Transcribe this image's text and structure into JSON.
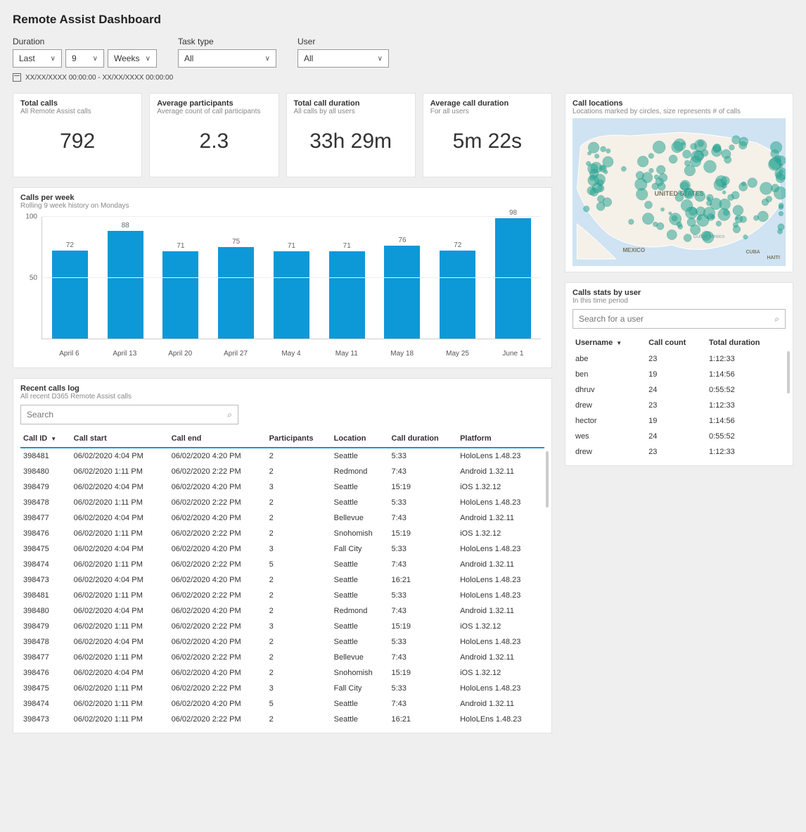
{
  "page": {
    "title": "Remote Assist Dashboard"
  },
  "filters": {
    "duration_label": "Duration",
    "duration_period": "Last",
    "duration_number": "9",
    "duration_unit": "Weeks",
    "task_label": "Task type",
    "task_value": "All",
    "user_label": "User",
    "user_value": "All",
    "date_range": "XX/XX/XXXX 00:00:00 - XX/XX/XXXX 00:00:00"
  },
  "kpis": [
    {
      "title": "Total calls",
      "subtitle": "All Remote Assist calls",
      "value": "792"
    },
    {
      "title": "Average participants",
      "subtitle": "Average count of call participants",
      "value": "2.3"
    },
    {
      "title": "Total call duration",
      "subtitle": "All calls by all users",
      "value": "33h 29m"
    },
    {
      "title": "Average call duration",
      "subtitle": "For all users",
      "value": "5m 22s"
    }
  ],
  "chart_data": {
    "type": "bar",
    "title": "Calls per week",
    "subtitle": "Rolling 9 week history on Mondays",
    "categories": [
      "April 6",
      "April 13",
      "April 20",
      "April 27",
      "May 4",
      "May 11",
      "May 18",
      "May 25",
      "June 1"
    ],
    "values": [
      72,
      88,
      71,
      75,
      71,
      71,
      76,
      72,
      98
    ],
    "ylim": [
      0,
      100
    ],
    "yticks": [
      50,
      100
    ],
    "xlabel": "",
    "ylabel": ""
  },
  "map": {
    "title": "Call locations",
    "subtitle": "Locations marked by circles, size represents # of calls",
    "country_label": "UNITED STATES",
    "gulf_label": "Gulf of Mexico",
    "mexico_label": "MEXICO",
    "cuba_label": "CUBA",
    "haiti_label": "HAITI"
  },
  "user_stats": {
    "title": "Calls stats by user",
    "subtitle": "In this time period",
    "search_placeholder": "Search for a user",
    "columns": {
      "username": "Username",
      "count": "Call count",
      "duration": "Total duration"
    },
    "rows": [
      {
        "username": "abe",
        "count": "23",
        "duration": "1:12:33"
      },
      {
        "username": "ben",
        "count": "19",
        "duration": "1:14:56"
      },
      {
        "username": "dhruv",
        "count": "24",
        "duration": "0:55:52"
      },
      {
        "username": "drew",
        "count": "23",
        "duration": "1:12:33"
      },
      {
        "username": "hector",
        "count": "19",
        "duration": "1:14:56"
      },
      {
        "username": "wes",
        "count": "24",
        "duration": "0:55:52"
      },
      {
        "username": "drew",
        "count": "23",
        "duration": "1:12:33"
      }
    ]
  },
  "calls_log": {
    "title": "Recent calls log",
    "subtitle": "All recent D365 Remote Assist calls",
    "search_placeholder": "Search",
    "columns": {
      "id": "Call ID",
      "start": "Call start",
      "end": "Call end",
      "participants": "Participants",
      "location": "Location",
      "duration": "Call duration",
      "platform": "Platform"
    },
    "rows": [
      {
        "id": "398481",
        "start": "06/02/2020 4:04 PM",
        "end": "06/02/2020 4:20 PM",
        "participants": "2",
        "location": "Seattle",
        "duration": "5:33",
        "platform": "HoloLens 1.48.23"
      },
      {
        "id": "398480",
        "start": "06/02/2020 1:11 PM",
        "end": "06/02/2020 2:22 PM",
        "participants": "2",
        "location": "Redmond",
        "duration": "7:43",
        "platform": "Android 1.32.11"
      },
      {
        "id": "398479",
        "start": "06/02/2020 4:04 PM",
        "end": "06/02/2020 4:20 PM",
        "participants": "3",
        "location": "Seattle",
        "duration": "15:19",
        "platform": "iOS 1.32.12"
      },
      {
        "id": "398478",
        "start": "06/02/2020 1:11 PM",
        "end": "06/02/2020 2:22 PM",
        "participants": "2",
        "location": "Seattle",
        "duration": "5:33",
        "platform": "HoloLens 1.48.23"
      },
      {
        "id": "398477",
        "start": "06/02/2020 4:04 PM",
        "end": "06/02/2020 4:20 PM",
        "participants": "2",
        "location": "Bellevue",
        "duration": "7:43",
        "platform": "Android 1.32.11"
      },
      {
        "id": "398476",
        "start": "06/02/2020 1:11 PM",
        "end": "06/02/2020 2:22 PM",
        "participants": "2",
        "location": "Snohomish",
        "duration": "15:19",
        "platform": "iOS 1.32.12"
      },
      {
        "id": "398475",
        "start": "06/02/2020 4:04 PM",
        "end": "06/02/2020 4:20 PM",
        "participants": "3",
        "location": "Fall City",
        "duration": "5:33",
        "platform": "HoloLens 1.48.23"
      },
      {
        "id": "398474",
        "start": "06/02/2020 1:11 PM",
        "end": "06/02/2020 2:22 PM",
        "participants": "5",
        "location": "Seattle",
        "duration": "7:43",
        "platform": "Android 1.32.11"
      },
      {
        "id": "398473",
        "start": "06/02/2020 4:04 PM",
        "end": "06/02/2020 4:20 PM",
        "participants": "2",
        "location": "Seattle",
        "duration": "16:21",
        "platform": "HoloLens 1.48.23"
      },
      {
        "id": "398481",
        "start": "06/02/2020 1:11 PM",
        "end": "06/02/2020 2:22 PM",
        "participants": "2",
        "location": "Seattle",
        "duration": "5:33",
        "platform": "HoloLens 1.48.23"
      },
      {
        "id": "398480",
        "start": "06/02/2020 4:04 PM",
        "end": "06/02/2020 4:20 PM",
        "participants": "2",
        "location": "Redmond",
        "duration": "7:43",
        "platform": "Android 1.32.11"
      },
      {
        "id": "398479",
        "start": "06/02/2020 1:11 PM",
        "end": "06/02/2020 2:22 PM",
        "participants": "3",
        "location": "Seattle",
        "duration": "15:19",
        "platform": "iOS 1.32.12"
      },
      {
        "id": "398478",
        "start": "06/02/2020 4:04 PM",
        "end": "06/02/2020 4:20 PM",
        "participants": "2",
        "location": "Seattle",
        "duration": "5:33",
        "platform": "HoloLens 1.48.23"
      },
      {
        "id": "398477",
        "start": "06/02/2020 1:11 PM",
        "end": "06/02/2020 2:22 PM",
        "participants": "2",
        "location": "Bellevue",
        "duration": "7:43",
        "platform": "Android 1.32.11"
      },
      {
        "id": "398476",
        "start": "06/02/2020 4:04 PM",
        "end": "06/02/2020 4:20 PM",
        "participants": "2",
        "location": "Snohomish",
        "duration": "15:19",
        "platform": "iOS 1.32.12"
      },
      {
        "id": "398475",
        "start": "06/02/2020 1:11 PM",
        "end": "06/02/2020 2:22 PM",
        "participants": "3",
        "location": "Fall City",
        "duration": "5:33",
        "platform": "HoloLens 1.48.23"
      },
      {
        "id": "398474",
        "start": "06/02/2020 1:11 PM",
        "end": "06/02/2020 4:20 PM",
        "participants": "5",
        "location": "Seattle",
        "duration": "7:43",
        "platform": "Android 1.32.11"
      },
      {
        "id": "398473",
        "start": "06/02/2020 1:11 PM",
        "end": "06/02/2020 2:22 PM",
        "participants": "2",
        "location": "Seattle",
        "duration": "16:21",
        "platform": "HoloLEns 1.48.23"
      }
    ]
  }
}
